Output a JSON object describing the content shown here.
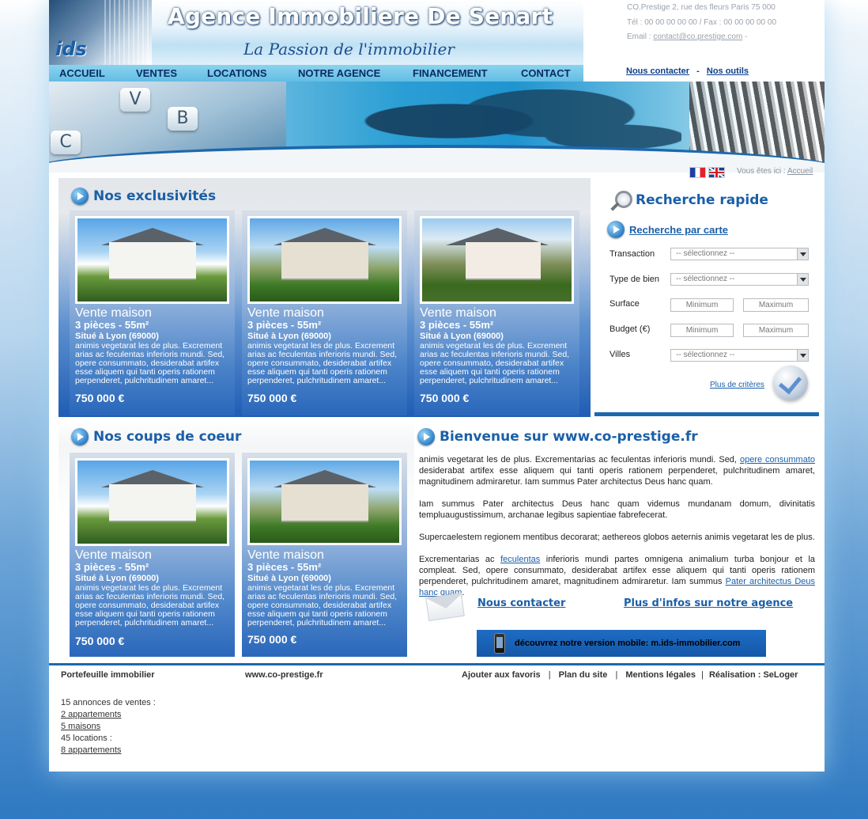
{
  "header": {
    "logo_badge": "ids",
    "title": "Agence Immobiliere De Senart",
    "tagline": "La Passion de l'immobilier",
    "contact": {
      "address": "CO.Prestige 2, rue des fleurs Paris 75 000",
      "phone_fax": "Tél : 00 00 00 00 00 / Fax : 00 00 00 00 00",
      "email_label": "Email :",
      "email": "contact@co.prestige.com",
      "email_suffix": "-"
    },
    "nav": [
      "ACCUEIL",
      "VENTES",
      "LOCATIONS",
      "NOTRE AGENCE",
      "FINANCEMENT",
      "CONTACT"
    ],
    "top_links": {
      "contact": "Nous contacter",
      "separator": "-",
      "tools": "Nos outils"
    }
  },
  "hero": {
    "keys": [
      "V",
      "B",
      "C"
    ]
  },
  "breadcrumb": {
    "label": "Vous êtes ici :",
    "current": "Accueil"
  },
  "exclusivites": {
    "title": "Nos exclusivités",
    "cards": [
      {
        "title": "Vente maison",
        "sub": "3 pièces - 55m²",
        "location": "Situé à Lyon (69000)",
        "desc": "animis vegetarat les de plus. Excrement arias ac feculentas inferioris mundi. Sed, opere consummato, desiderabat artifex esse aliquem qui tanti operis rationem perpenderet, pulchritudinem amaret...",
        "price": "750 000 €"
      },
      {
        "title": "Vente maison",
        "sub": "3 pièces - 55m²",
        "location": "Situé à Lyon (69000)",
        "desc": "animis vegetarat les de plus. Excrement arias ac feculentas inferioris mundi. Sed, opere consummato, desiderabat artifex esse aliquem qui tanti operis rationem perpenderet, pulchritudinem amaret...",
        "price": "750 000 €"
      },
      {
        "title": "Vente maison",
        "sub": "3 pièces - 55m²",
        "location": "Situé à Lyon (69000)",
        "desc": "animis vegetarat les de plus. Excrement arias ac feculentas inferioris mundi. Sed, opere consummato, desiderabat artifex esse aliquem qui tanti operis rationem perpenderet, pulchritudinem amaret...",
        "price": "750 000 €"
      }
    ]
  },
  "search": {
    "title": "Recherche rapide",
    "map_link": "Recherche par carte",
    "transaction_label": "Transaction",
    "type_label": "Type de bien",
    "surface_label": "Surface",
    "budget_label": "Budget (€)",
    "villes_label": "Villes",
    "select_placeholder": "-- sélectionnez --",
    "min_placeholder": "Minimum",
    "max_placeholder": "Maximum",
    "more_link": "Plus de critères"
  },
  "coups_de_coeur": {
    "title": "Nos coups de coeur",
    "cards": [
      {
        "title": "Vente maison",
        "sub": "3 pièces - 55m²",
        "location": "Situé à Lyon (69000)",
        "desc": "animis vegetarat les de plus. Excrement arias ac feculentas inferioris mundi. Sed, opere consummato, desiderabat artifex esse aliquem qui tanti operis rationem perpenderet, pulchritudinem amaret...",
        "price": "750 000 €"
      },
      {
        "title": "Vente maison",
        "sub": "3 pièces - 55m²",
        "location": "Situé à Lyon (69000)",
        "desc": "animis vegetarat les de plus. Excrement arias ac feculentas inferioris mundi. Sed, opere consummato, desiderabat artifex esse aliquem qui tanti operis rationem perpenderet, pulchritudinem amaret...",
        "price": "750 000 €"
      }
    ]
  },
  "welcome": {
    "title": "Bienvenue sur www.co-prestige.fr",
    "p1_text": "animis vegetarat les de plus. Excrementarias ac feculentas inferioris mundi. Sed,",
    "p1_link": "opere consummato",
    "p1_rest": "desiderabat artifex esse aliquem qui tanti operis rationem perpenderet, pulchritudinem amaret, magnitudinem admiraretur. Iam summus Pater architectus Deus hanc quam.",
    "p2": "Iam summus Pater architectus Deus hanc quam videmus mundanam domum, divinitatis templuaugustissimum, archanae legibus sapientiae fabrefecerat.",
    "p3": "Supercaelestem regionem mentibus decorarat; aethereos globos aeternis animis vegetarat les de plus.",
    "p4_start": "Excrementarias ac",
    "p4_link1": "feculentas",
    "p4_mid": "inferioris mundi partes omnigena animalium turba bonjour et la compleat. Sed, opere consummato, desiderabat artifex esse aliquem qui tanti operis rationem perpenderet, pulchritudinem amaret, magnitudinem admiraretur. Iam summus",
    "p4_link2": "Pater architectus Deus hanc quam",
    "p4_end": ".",
    "contact_link": "Nous contacter",
    "agency_link": "Plus d'infos sur notre agence",
    "mobile_banner": "découvrez notre version mobile:  m.ids-immobilier.com"
  },
  "footer": {
    "portfolio": "Portefeuille immobilier",
    "site": "www.co-prestige.fr",
    "links": [
      "Ajouter aux favoris",
      "Plan du site",
      "Mentions légales",
      "Réalisation : SeLoger"
    ],
    "separator": "|",
    "stats": {
      "sales": "15 annonces de ventes :",
      "sale_links": [
        "2 appartements",
        "5 maisons"
      ],
      "rentals": "45 locations :",
      "rental_links": [
        "8 appartements"
      ]
    }
  }
}
